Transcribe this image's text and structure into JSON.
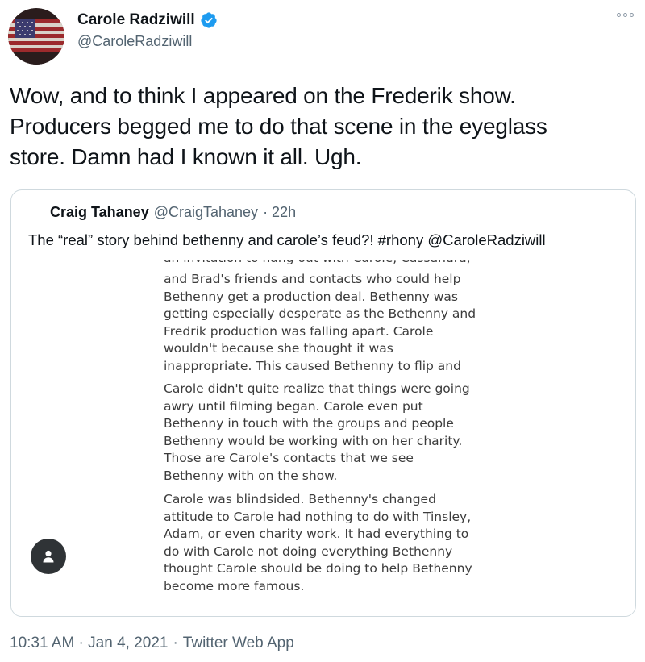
{
  "colors": {
    "text": "#0f1419",
    "secondary": "#536471",
    "border": "#cfd9de",
    "verified_blue": "#1d9bf0",
    "flag_red": "#b22234",
    "flag_blue": "#3c3b6e"
  },
  "tweet": {
    "author_name": "Carole Radziwill",
    "author_handle": "@CaroleRadziwill",
    "avatar_icon": "american-flag-avatar",
    "verified_icon": "verified-badge-icon",
    "more_icon": "more-options-icon",
    "text_lines": [
      "Wow, and to think I appeared on the Frederik show.",
      "Producers begged me to do that scene in the eyeglass",
      "store. Damn had I known it all. Ugh."
    ],
    "timestamp": "10:31 AM · Jan 4, 2021",
    "separator": "·",
    "source": "Twitter Web App"
  },
  "quote": {
    "author_name": "Craig Tahaney",
    "author_handle": "@CraigTahaney",
    "time": "· 22h",
    "text": "The “real” story behind bethenny and carole’s feud?! #rhony @CaroleRadziwill",
    "image": {
      "cut_line": "an invitation to hang out with Carole, Cassandra,",
      "para1": [
        "and Brad's friends and contacts who could help",
        "Bethenny get a production deal. Bethenny was",
        "getting especially desperate as the Bethenny and",
        "Fredrik production was falling apart. Carole",
        "wouldn't because she thought it was",
        "inappropriate. This caused Bethenny to flip and"
      ],
      "para2": [
        "Carole didn't quite realize that things were going",
        "awry until filming began. Carole even put",
        "Bethenny in touch with the groups and people",
        "Bethenny would be working with on her charity.",
        "Those are Carole's contacts that we see",
        "Bethenny with on the show."
      ],
      "para3": [
        "Carole was blindsided. Bethenny's changed",
        "attitude to Carole had nothing to do with Tinsley,",
        "Adam, or even charity work. It had everything to",
        "do with Carole not doing everything Bethenny",
        "thought Carole should be doing to help Bethenny",
        "become more famous."
      ],
      "alt_icon": "person-icon"
    }
  }
}
